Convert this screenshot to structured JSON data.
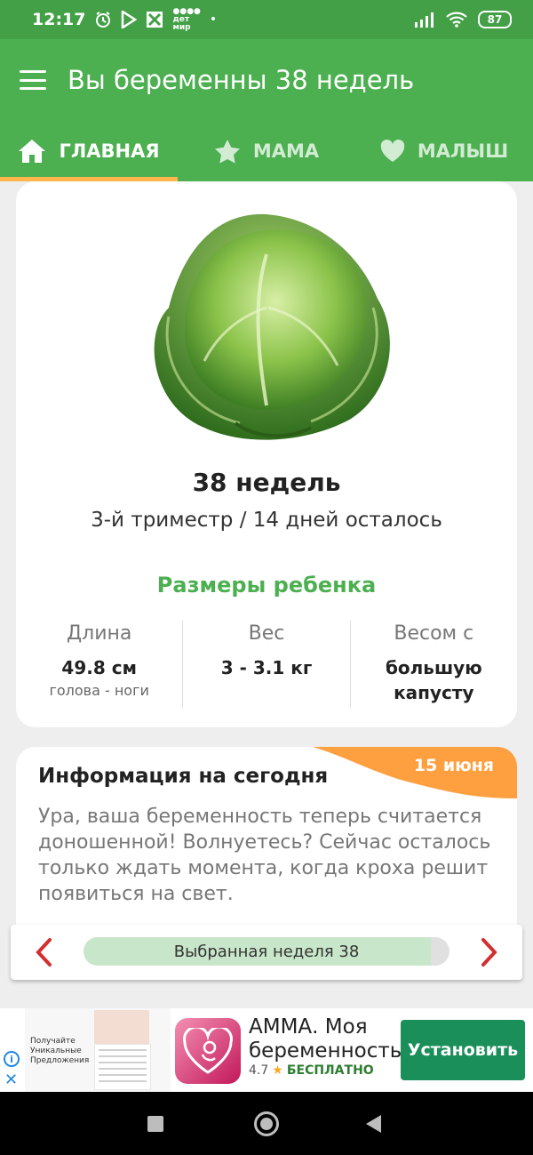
{
  "status_bar": {
    "time": "12:17",
    "battery": "87",
    "detmir_line1": "дет",
    "detmir_line2": "мир"
  },
  "app_bar": {
    "title": "Вы беременны 38 недель"
  },
  "tabs": [
    {
      "label": "ГЛАВНАЯ",
      "icon": "home-icon",
      "active": true
    },
    {
      "label": "МАМА",
      "icon": "star-icon",
      "active": false
    },
    {
      "label": "МАЛЫШ",
      "icon": "heart-icon",
      "active": false
    }
  ],
  "week_card": {
    "image": "cabbage",
    "week_title": "38 недель",
    "subtitle": "3-й триместр / 14 дней осталось",
    "sizes_title": "Размеры ребенка",
    "stats": [
      {
        "label": "Длина",
        "value": "49.8 см",
        "note": "голова - ноги"
      },
      {
        "label": "Вес",
        "value": "3 - 3.1 кг",
        "note": ""
      },
      {
        "label": "Весом с",
        "value": "большую капусту",
        "note": ""
      }
    ]
  },
  "info_card": {
    "title": "Информация на сегодня",
    "date": "15 июня",
    "body": "Ура, ваша беременность теперь считается доношенной! Волнуетесь? Сейчас осталось только ждать момента, когда кроха решит появиться на свет."
  },
  "week_nav": {
    "label": "Выбранная неделя 38",
    "progress": 0.95
  },
  "ad": {
    "thumb_text": "Получайте Уникальные Предложения",
    "app_title": "АММА. Моя беременность",
    "rating": "4.7",
    "price": "БЕСПЛАТНО",
    "install_label": "Установить"
  },
  "colors": {
    "primary": "#4caf50",
    "status_bar": "#43a047",
    "accent": "#ffa040",
    "nav_arrow": "#d32f2f",
    "install": "#1b8f5a"
  }
}
